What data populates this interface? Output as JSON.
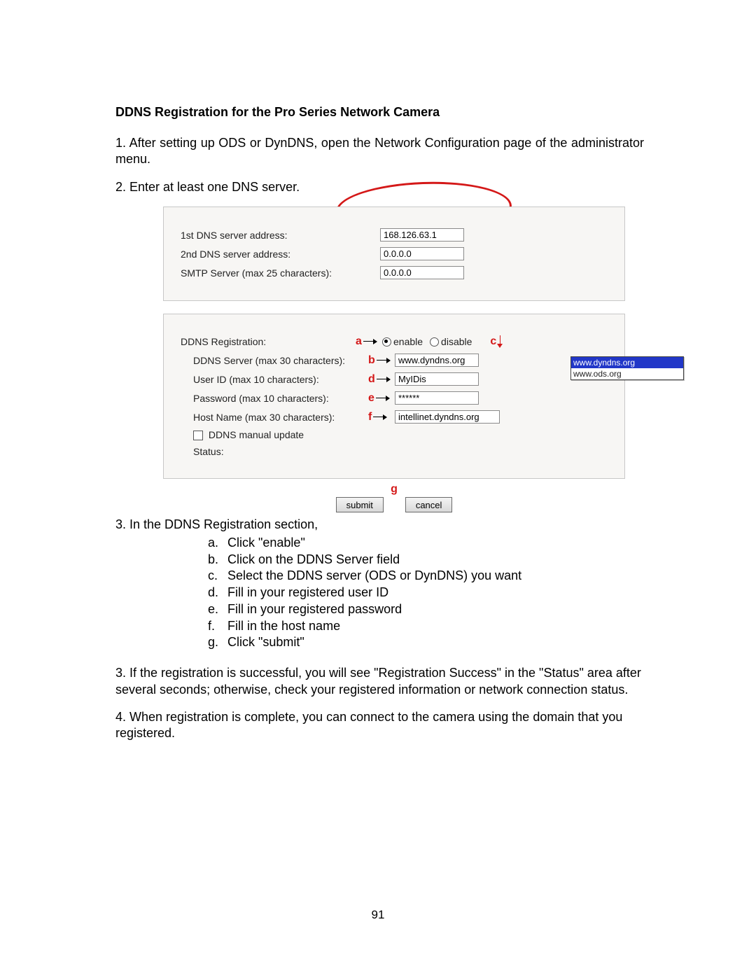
{
  "heading": "DDNS Registration for the Pro Series Network Camera",
  "para1": "1. After setting up ODS or DynDNS, open the Network Configuration page of the administrator menu.",
  "para2": "2. Enter at least one DNS server.",
  "dns_panel": {
    "label_1st": "1st DNS server address:",
    "value_1st": "168.126.63.1",
    "label_2nd": "2nd DNS server address:",
    "value_2nd": "0.0.0.0",
    "label_smtp": "SMTP Server (max 25 characters):",
    "value_smtp": "0.0.0.0"
  },
  "ddns_panel": {
    "label_reg": "DDNS Registration:",
    "label_server": "DDNS Server (max 30 characters):",
    "value_server": "www.dyndns.org",
    "label_user": "User ID (max 10 characters):",
    "value_user": "MyIDis",
    "label_pass": "Password (max 10 characters):",
    "value_pass": "******",
    "label_host": "Host Name (max 30 characters):",
    "value_host": "intellinet.dyndns.org",
    "label_manual": "DDNS manual update",
    "label_status": "Status:",
    "radio_enable": "enable",
    "radio_disable": "disable",
    "dropdown_opt1": "www.dyndns.org",
    "dropdown_opt2": "www.ods.org"
  },
  "annot": {
    "a": "a",
    "b": "b",
    "c": "c",
    "d": "d",
    "e": "e",
    "f": "f",
    "g": "g"
  },
  "buttons": {
    "submit": "submit",
    "cancel": "cancel"
  },
  "para3intro": "3. In the DDNS Registration section,",
  "sub_a": "Click \"enable\"",
  "sub_b": "Click on the DDNS Server field",
  "sub_c": "Select the DDNS server (ODS or DynDNS) you want",
  "sub_d": "Fill in your registered user ID",
  "sub_e": "Fill in your registered password",
  "sub_f": "Fill in the host name",
  "sub_g": "Click \"submit\"",
  "para4": "3. If the registration is successful, you will see \"Registration Success\" in the \"Status\" area after several seconds; otherwise, check your registered information or network connection status.",
  "para5": "4. When registration is complete, you can connect to the camera using the domain that you registered.",
  "pagenum": "91"
}
